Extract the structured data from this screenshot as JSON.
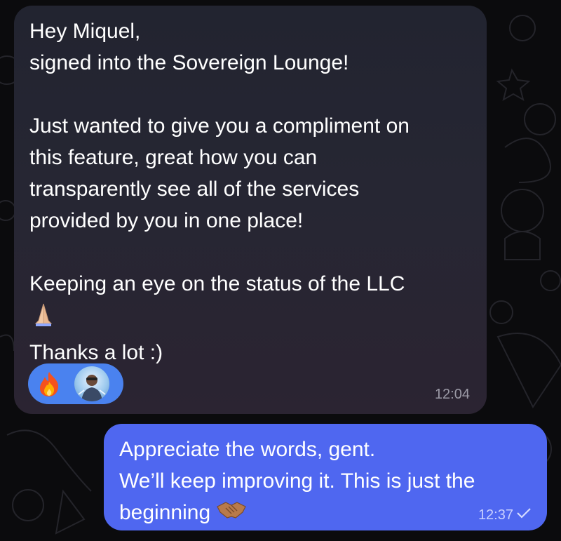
{
  "incoming_message": {
    "lines": [
      "Hey Miquel,",
      "signed into the Sovereign Lounge!",
      "",
      "Just wanted to give you a compliment on",
      "this feature, great how you can",
      "transparently see all of the services",
      "provided by you in one place!",
      "",
      "Keeping an eye on the status of the LLC",
      "",
      "Thanks a lot :)"
    ],
    "time": "12:04",
    "reaction": {
      "emoji_icon": "fire-icon",
      "reactor": "avatar"
    }
  },
  "outgoing_message": {
    "lines": [
      "Appreciate the words, gent.",
      "We’ll keep improving it. This is just the",
      "beginning"
    ],
    "time": "12:37",
    "status_icon": "checkmark-icon"
  },
  "colors": {
    "incoming_bubble": "#262633",
    "outgoing_bubble": "#4f67f0",
    "reaction_pill": "#4a82ef",
    "timestamp": "#9b9aa6"
  }
}
